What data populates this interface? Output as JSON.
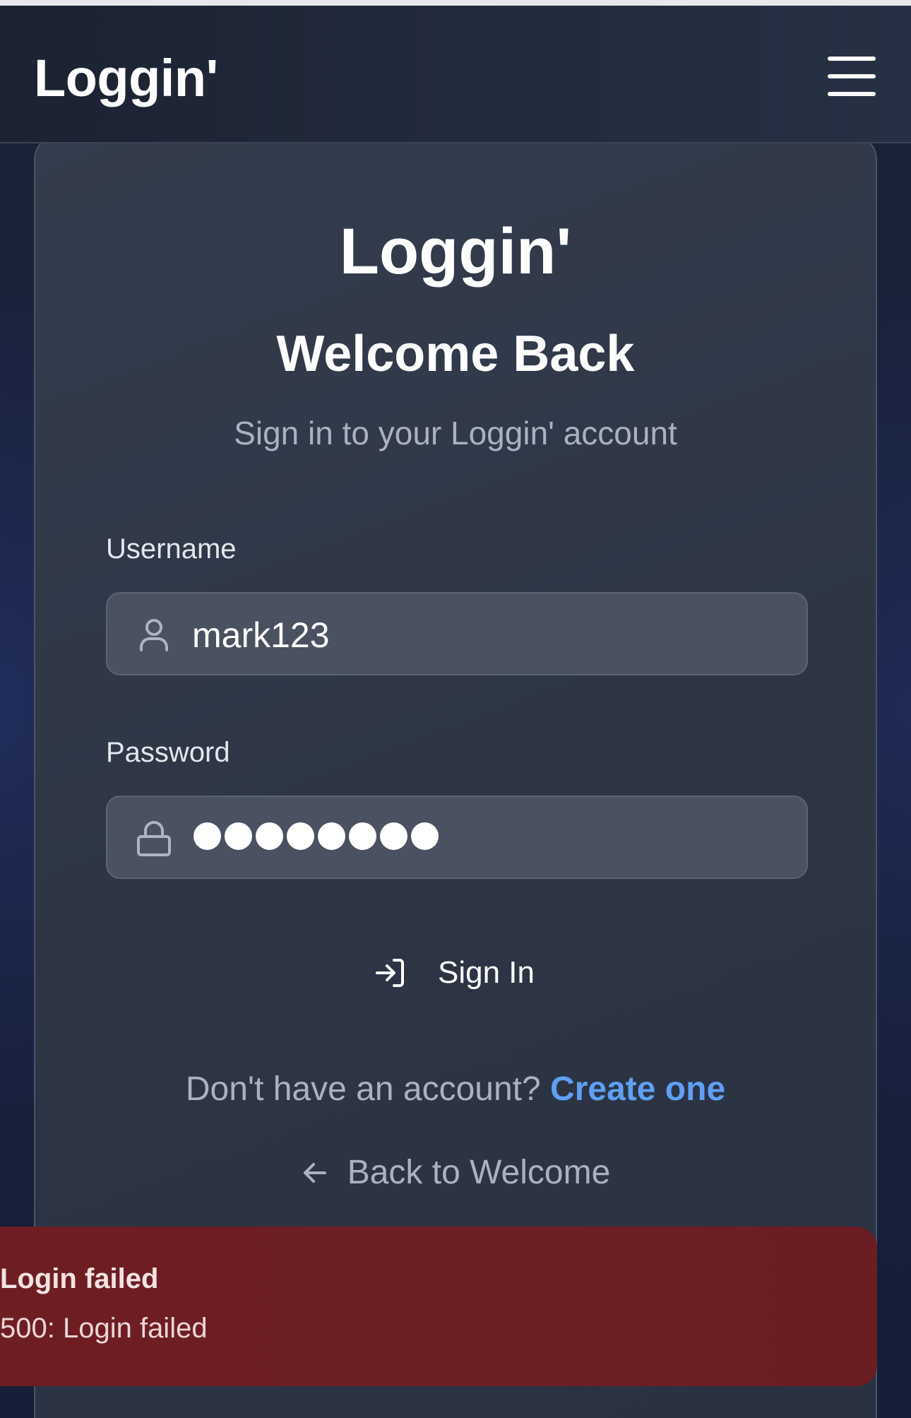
{
  "header": {
    "brand": "Loggin'",
    "menu_icon": "hamburger-menu-icon"
  },
  "card": {
    "title": "Loggin'",
    "subtitle": "Welcome Back",
    "description": "Sign in to your Loggin' account"
  },
  "form": {
    "username": {
      "label": "Username",
      "value": "mark123",
      "icon": "user-icon"
    },
    "password": {
      "label": "Password",
      "masked_length": 8,
      "icon": "lock-icon"
    },
    "submit": {
      "label": "Sign In",
      "icon": "sign-in-icon"
    }
  },
  "footer_links": {
    "prompt": "Don't have an account?",
    "create_link": "Create one",
    "back_label": "Back to Welcome",
    "back_icon": "arrow-left-icon"
  },
  "toast": {
    "title": "Login failed",
    "message": "500: Login failed"
  },
  "colors": {
    "background": "#161f38",
    "card": "#2e3646",
    "input": "#4a5160",
    "link": "#5fa0f5",
    "toast": "#6d1f24"
  }
}
